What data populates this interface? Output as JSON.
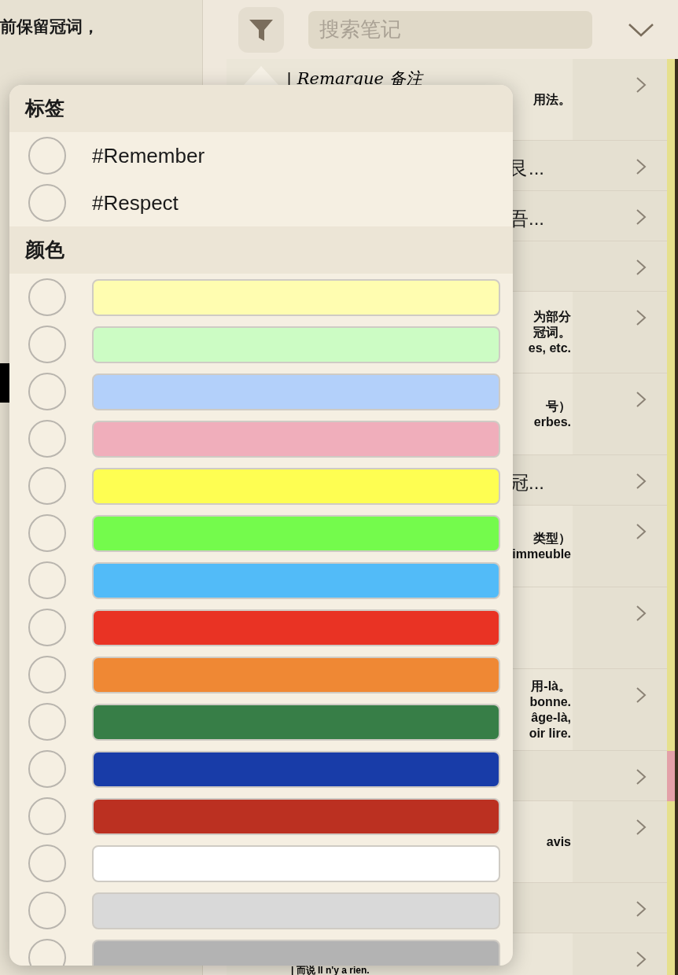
{
  "left_pane": {
    "lines": [
      "前保留冠词，"
    ]
  },
  "toolbar": {
    "search": {
      "placeholder": "搜索笔记"
    }
  },
  "notes": [
    {
      "kind": "excerpt",
      "heading": "| Remarque 备注",
      "lines": [
        "用法。"
      ],
      "color": "#e6e08c"
    },
    {
      "kind": "text",
      "title": "艮...",
      "color": "#e6e08c"
    },
    {
      "kind": "text",
      "title": "吾...",
      "color": "#e6e08c"
    },
    {
      "kind": "text",
      "color": "#e6e08c"
    },
    {
      "kind": "excerpt",
      "lines": [
        "为部分",
        "冠词。",
        "es, etc."
      ],
      "color": "#e6e08c"
    },
    {
      "kind": "excerpt",
      "lines": [
        "号）",
        "erbes."
      ],
      "color": "#e6e08c"
    },
    {
      "kind": "text",
      "title": "冠...",
      "color": "#e6e08c"
    },
    {
      "kind": "excerpt",
      "lines": [
        "类型）",
        "immeuble"
      ],
      "color": "#e6e08c"
    },
    {
      "kind": "excerpt",
      "color": "#e6e08c"
    },
    {
      "kind": "excerpt",
      "lines": [
        "用-là。",
        "bonne.",
        "âge-là,",
        "oir lire."
      ],
      "color": "#e6e08c"
    },
    {
      "kind": "text",
      "color": "#e4a0a8"
    },
    {
      "kind": "excerpt",
      "lines": [
        "avis"
      ],
      "color": "#e6e08c"
    },
    {
      "kind": "text",
      "color": "#e6e08c"
    },
    {
      "kind": "excerpt",
      "heading": "| 而说 Il n'y a rien.",
      "color": "#e6e08c"
    }
  ],
  "filter_popover": {
    "tags_header": "标签",
    "tags": [
      {
        "label": "#Remember",
        "selected": false
      },
      {
        "label": "#Respect",
        "selected": false
      }
    ],
    "colors_header": "颜色",
    "colors": [
      {
        "color": "#fffdb0",
        "selected": false
      },
      {
        "color": "#ccfcc4",
        "selected": false
      },
      {
        "color": "#b3d0fa",
        "selected": false
      },
      {
        "color": "#f0aebb",
        "selected": false
      },
      {
        "color": "#fefe52",
        "selected": false
      },
      {
        "color": "#74fb4c",
        "selected": false
      },
      {
        "color": "#52bbf8",
        "selected": false
      },
      {
        "color": "#e93324",
        "selected": false
      },
      {
        "color": "#ef8834",
        "selected": false
      },
      {
        "color": "#377e47",
        "selected": false
      },
      {
        "color": "#183ca8",
        "selected": false
      },
      {
        "color": "#bb3021",
        "selected": false
      },
      {
        "color": "#ffffff",
        "selected": false
      },
      {
        "color": "#d9d9d9",
        "selected": false
      },
      {
        "color": "#b3b3b3",
        "selected": false
      }
    ]
  }
}
